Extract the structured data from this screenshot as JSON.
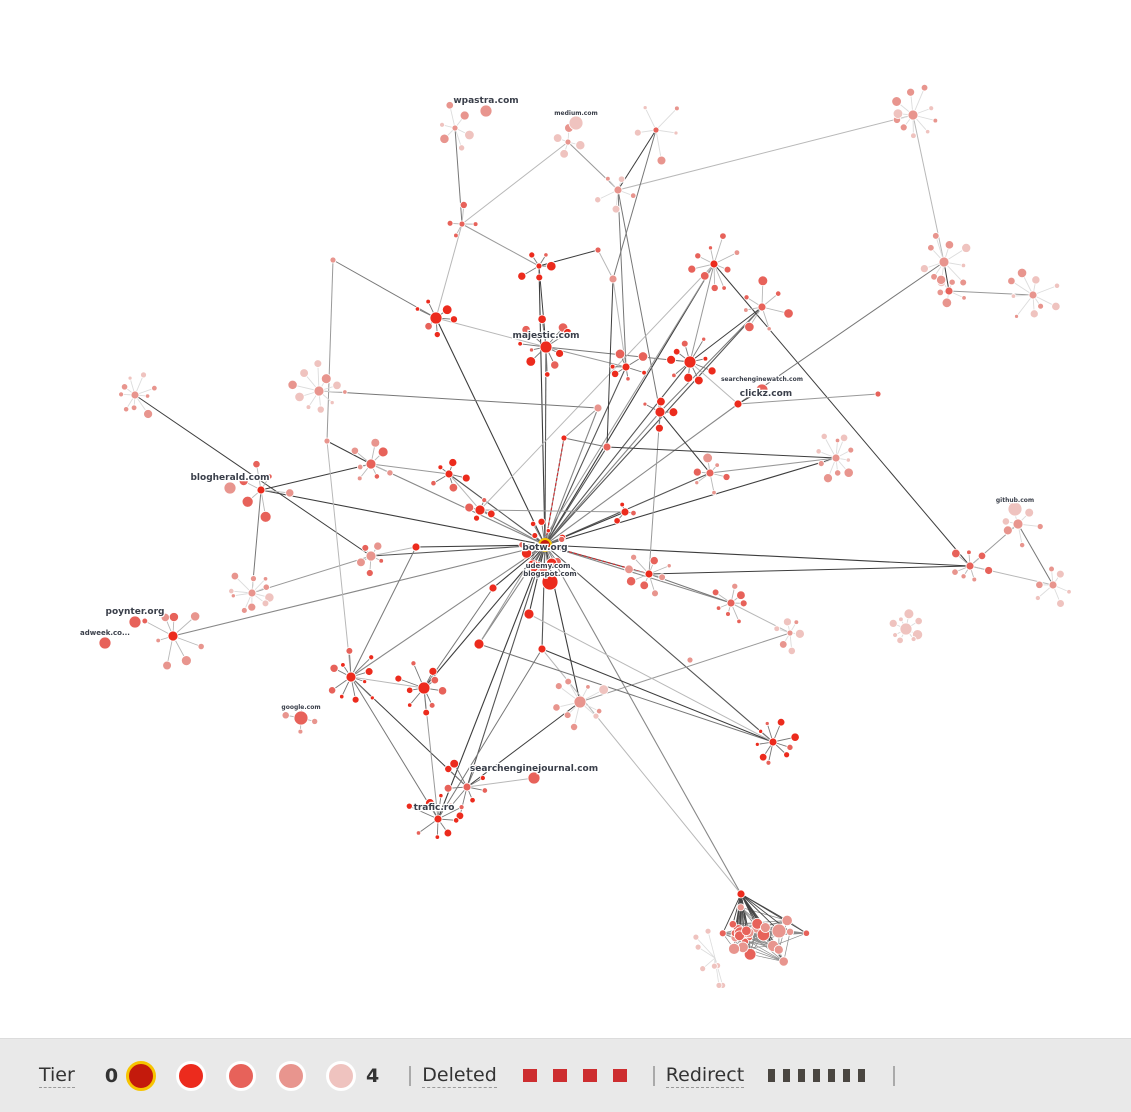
{
  "legend": {
    "tier_label": "Tier",
    "tier_min": "0",
    "tier_max": "4",
    "tiers": [
      {
        "tier": 0,
        "color": "#c41a0c",
        "ring": "#f7c400"
      },
      {
        "tier": 1,
        "color": "#ec2b1d",
        "ring": "#ffffff"
      },
      {
        "tier": 2,
        "color": "#e7625a",
        "ring": "#ffffff"
      },
      {
        "tier": 3,
        "color": "#e8958e",
        "ring": "#ffffff"
      },
      {
        "tier": 4,
        "color": "#efc3bf",
        "ring": "#ffffff"
      }
    ],
    "deleted_label": "Deleted",
    "deleted_color": "#cd2e30",
    "deleted_count": 4,
    "redirect_label": "Redirect",
    "redirect_color": "#4a4641",
    "redirect_count": 7
  },
  "graph": {
    "root": "botw.org",
    "tier_colors": [
      "#c41a0c",
      "#ec2b1d",
      "#e7625a",
      "#e8958e",
      "#efc3bf"
    ],
    "labels": [
      {
        "text": "botw.org",
        "node": "botw",
        "size": "big"
      },
      {
        "text": "udemy.com",
        "node": "udemy",
        "size": "mid"
      },
      {
        "text": "blogspot.com",
        "node": "blogspot",
        "size": "mid"
      },
      {
        "text": "majestic.com",
        "node": "majestic",
        "size": "big"
      },
      {
        "text": "wpastra.com",
        "node": "wpastra",
        "size": "big"
      },
      {
        "text": "medium.com",
        "node": "medium",
        "size": "small"
      },
      {
        "text": "searchenginewatch.com",
        "node": "sew",
        "size": "small"
      },
      {
        "text": "clickz.com",
        "node": "clickz",
        "size": "big"
      },
      {
        "text": "blogherald.com",
        "node": "blogherald",
        "size": "big"
      },
      {
        "text": "poynter.org",
        "node": "poynter",
        "size": "big"
      },
      {
        "text": "adweek.co...",
        "node": "adweek",
        "size": "mid"
      },
      {
        "text": "google.com",
        "node": "google",
        "size": "small"
      },
      {
        "text": "searchenginejournal.com",
        "node": "sej",
        "size": "big"
      },
      {
        "text": "trafic.ro",
        "node": "traficro",
        "size": "big"
      },
      {
        "text": "github.com",
        "node": "github",
        "size": "small"
      }
    ]
  }
}
